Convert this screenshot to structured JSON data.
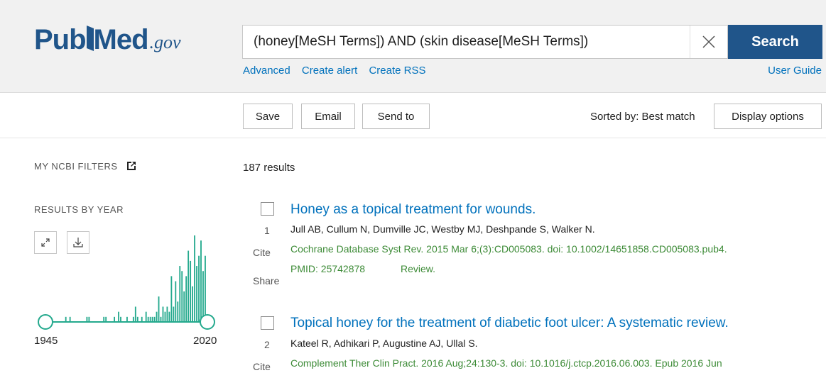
{
  "header": {
    "logo": {
      "pub": "Pub",
      "med": "Med",
      "gov": ".gov"
    },
    "search": {
      "query": "(honey[MeSH Terms]) AND (skin disease[MeSH Terms])",
      "button_label": "Search"
    },
    "links": {
      "advanced": "Advanced",
      "create_alert": "Create alert",
      "create_rss": "Create RSS",
      "user_guide": "User Guide"
    }
  },
  "toolbar": {
    "save": "Save",
    "email": "Email",
    "send_to": "Send to",
    "sorted_by": "Sorted by: Best match",
    "display_options": "Display options"
  },
  "sidebar": {
    "my_ncbi_filters": "MY NCBI FILTERS",
    "results_by_year": "RESULTS BY YEAR",
    "year_start": "1945",
    "year_end": "2020",
    "accent_color": "#24a98d"
  },
  "chart_data": {
    "type": "bar",
    "x_range": [
      1945,
      2020
    ],
    "values": [
      0,
      0,
      0,
      0,
      0,
      0,
      0,
      0,
      0,
      1,
      0,
      1,
      0,
      0,
      0,
      0,
      0,
      0,
      0,
      1,
      1,
      0,
      0,
      0,
      0,
      0,
      0,
      1,
      1,
      0,
      0,
      0,
      1,
      0,
      2,
      1,
      0,
      0,
      1,
      0,
      0,
      1,
      3,
      1,
      0,
      1,
      0,
      2,
      1,
      1,
      1,
      1,
      2,
      5,
      1,
      3,
      2,
      3,
      2,
      9,
      3,
      8,
      4,
      11,
      10,
      6,
      9,
      14,
      12,
      7,
      17,
      11,
      13,
      16,
      10,
      13
    ]
  },
  "results": {
    "count": "187 results",
    "items": [
      {
        "number": "1",
        "title": "Honey as a topical treatment for wounds.",
        "authors": "Jull AB, Cullum N, Dumville JC, Westby MJ, Deshpande S, Walker N.",
        "citation": "Cochrane Database Syst Rev. 2015 Mar 6;(3):CD005083. doi: 10.1002/14651858.CD005083.pub4.",
        "pmid": "PMID: 25742878",
        "type": "Review.",
        "cite": "Cite",
        "share": "Share"
      },
      {
        "number": "2",
        "title": "Topical honey for the treatment of diabetic foot ulcer: A systematic review.",
        "authors": "Kateel R, Adhikari P, Augustine AJ, Ullal S.",
        "citation": "Complement Ther Clin Pract. 2016 Aug;24:130-3. doi: 10.1016/j.ctcp.2016.06.003. Epub 2016 Jun",
        "cite": "Cite"
      }
    ]
  }
}
